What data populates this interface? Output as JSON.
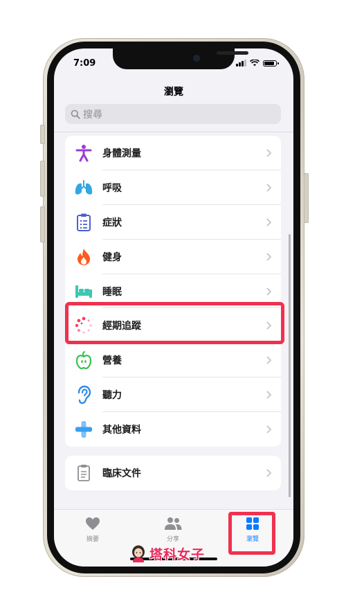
{
  "status_bar": {
    "time": "7:09"
  },
  "nav": {
    "title": "瀏覽"
  },
  "search": {
    "placeholder": "搜尋"
  },
  "categories": [
    {
      "label": "身體測量",
      "icon": "person-figure-icon",
      "color": "#9b3bd9"
    },
    {
      "label": "呼吸",
      "icon": "lungs-icon",
      "color": "#33a8e0"
    },
    {
      "label": "症狀",
      "icon": "clipboard-icon",
      "color": "#4b5fd1"
    },
    {
      "label": "健身",
      "icon": "flame-icon",
      "color": "#ff5a1f"
    },
    {
      "label": "睡眠",
      "icon": "bed-icon",
      "color": "#3cc7b4"
    },
    {
      "label": "經期追蹤",
      "icon": "cycle-dots-icon",
      "color": "#ff3b5f"
    },
    {
      "label": "營養",
      "icon": "apple-icon",
      "color": "#35c24a"
    },
    {
      "label": "聽力",
      "icon": "ear-icon",
      "color": "#2e8be8"
    },
    {
      "label": "其他資料",
      "icon": "plus-cross-icon",
      "color": "#3a9ff0"
    }
  ],
  "records": [
    {
      "label": "臨床文件",
      "icon": "document-icon",
      "color": "#8e8e93"
    }
  ],
  "tabs": [
    {
      "label": "摘要",
      "icon": "heart-icon"
    },
    {
      "label": "分享",
      "icon": "people-icon"
    },
    {
      "label": "瀏覽",
      "icon": "grid-icon",
      "active": true
    }
  ],
  "colors": {
    "accent": "#0a7aff",
    "highlight": "#f0314f"
  },
  "watermark": {
    "text": "塔科女子"
  }
}
